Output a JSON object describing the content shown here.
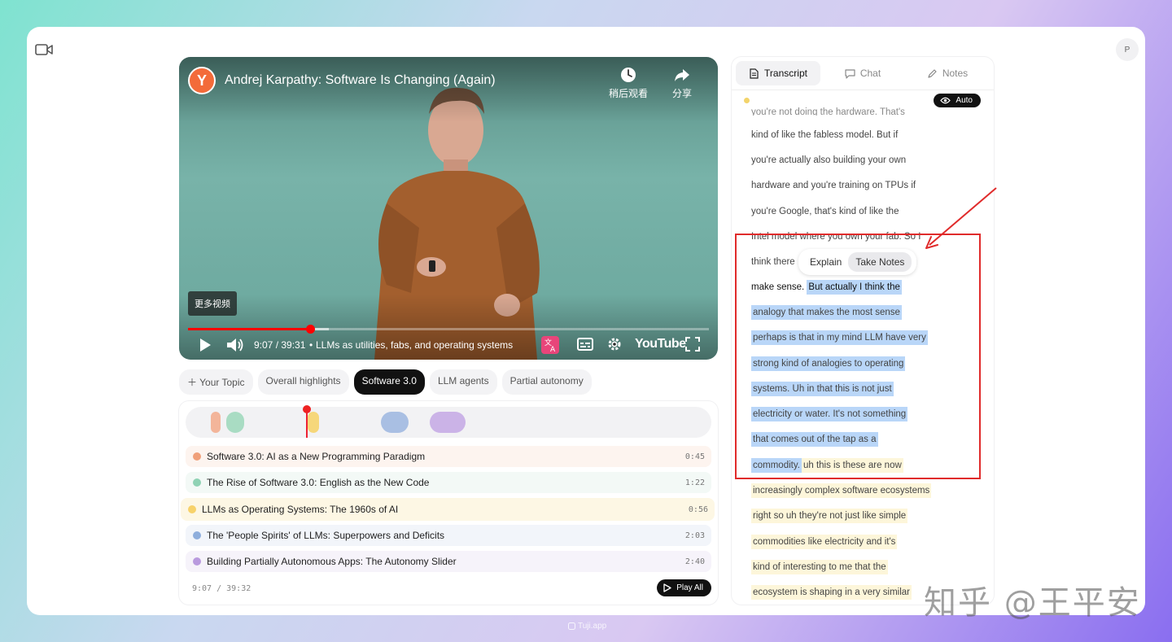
{
  "video": {
    "title": "Andrej Karpathy: Software Is Changing (Again)",
    "channel_initial": "Y",
    "watch_later_label": "稍后观看",
    "share_label": "分享",
    "more_videos_label": "更多视频",
    "time": "9:07 / 39:31",
    "chapter_title": "LLMs as utilities, fabs, and operating systems",
    "youtube_label": "YouTube",
    "progress_played": 0.235,
    "progress_buffered": 0.27
  },
  "topics": {
    "add_label": "Your Topic",
    "items": [
      "Overall highlights",
      "Software 3.0",
      "LLM agents",
      "Partial autonomy"
    ],
    "active": "Software 3.0"
  },
  "chapters": {
    "items": [
      {
        "title": "Software 3.0: AI as a New Programming Paradigm",
        "time": "0:45",
        "color": "#f0a07a",
        "bg": "#fdf4ef"
      },
      {
        "title": "The Rise of Software 3.0: English as the New Code",
        "time": "1:22",
        "color": "#8fd2b4",
        "bg": "#f3f9f6"
      },
      {
        "title": "LLMs as Operating Systems: The 1960s of AI",
        "time": "0:56",
        "color": "#f7d26a",
        "bg": "#fdf7e4"
      },
      {
        "title": "The 'People Spirits' of LLMs: Superpowers and Deficits",
        "time": "2:03",
        "color": "#8eaedc",
        "bg": "#f2f5fa"
      },
      {
        "title": "Building Partially Autonomous Apps: The Autonomy Slider",
        "time": "2:40",
        "color": "#b99ade",
        "bg": "#f6f3fa"
      }
    ],
    "footer_time": "9:07  /  39:32",
    "play_all_label": "Play All"
  },
  "panel": {
    "tabs": [
      "Transcript",
      "Chat",
      "Notes"
    ],
    "active_tab": "Transcript",
    "auto_label": "Auto"
  },
  "transcript": {
    "cut_line": "you're not doing the hardware. That's",
    "lines": [
      "kind of like the fabless model. But if",
      "you're actually also building your own",
      "hardware and you're training on TPUs if",
      "you're Google, that's kind of like the",
      "Intel model where you own your fab. So I",
      "think there"
    ],
    "line7_prefix": "make sense.",
    "selected": [
      "But actually I think the",
      "analogy that makes the most sense",
      "perhaps is that in my mind LLM have very",
      "strong kind of analogies to operating",
      "systems. Uh in that this is not just",
      "electricity or water. It's not something",
      "that comes out of the tap as a",
      "commodity."
    ],
    "after_selection": "uh this is these are now",
    "highlighted": [
      "increasingly complex software ecosystems",
      "right so uh they're not just like simple",
      "commodities like electricity and it's",
      "kind of interesting to me that the",
      "ecosystem is shaping in a very similar"
    ]
  },
  "popup": {
    "explain_label": "Explain",
    "take_notes_label": "Take Notes"
  },
  "watermark": "知乎 @王平安",
  "brand": "Tuji.app",
  "avatar_initial": "P"
}
